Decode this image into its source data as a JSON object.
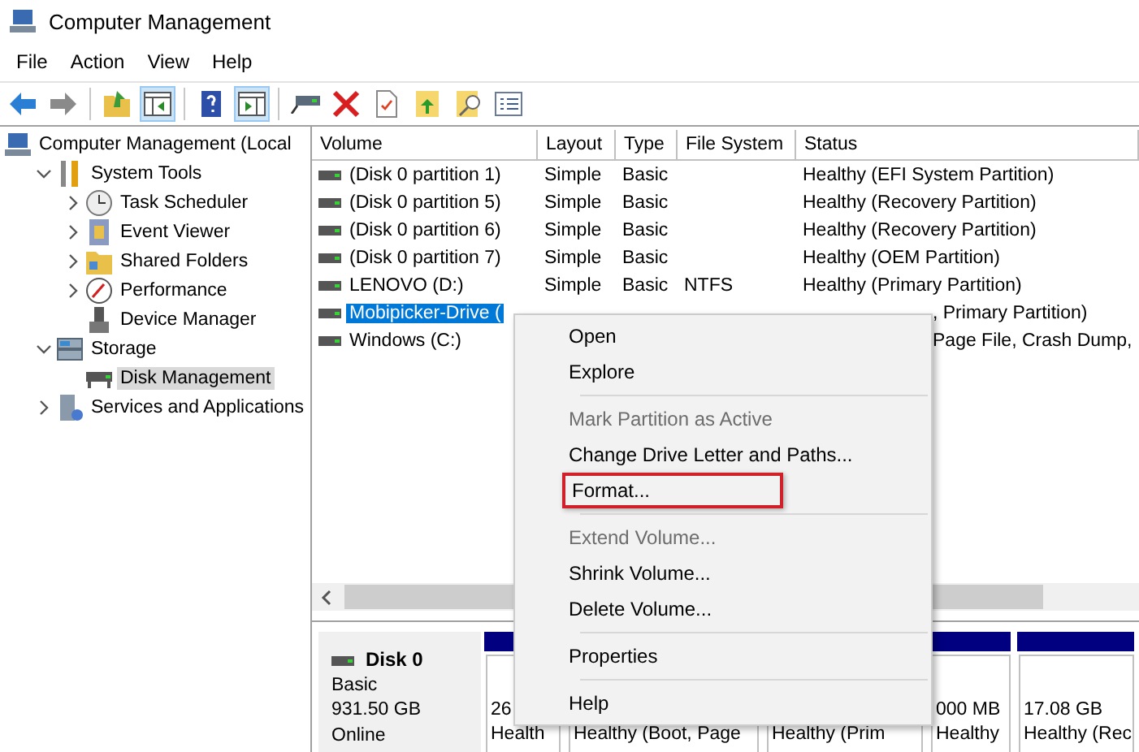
{
  "window": {
    "title": "Computer Management"
  },
  "menu_bar": [
    "File",
    "Action",
    "View",
    "Help"
  ],
  "toolbar": [
    {
      "kind": "back",
      "pressed": false
    },
    {
      "kind": "forward",
      "pressed": false
    },
    {
      "kind": "sep"
    },
    {
      "kind": "up",
      "pressed": false
    },
    {
      "kind": "tree",
      "pressed": true
    },
    {
      "kind": "sep"
    },
    {
      "kind": "help",
      "pressed": false
    },
    {
      "kind": "pane",
      "pressed": true
    },
    {
      "kind": "sep"
    },
    {
      "kind": "drive",
      "pressed": false
    },
    {
      "kind": "delete",
      "pressed": false
    },
    {
      "kind": "check",
      "pressed": false
    },
    {
      "kind": "folderup",
      "pressed": false
    },
    {
      "kind": "search",
      "pressed": false
    },
    {
      "kind": "list",
      "pressed": false
    }
  ],
  "tree": [
    {
      "label": "Computer Management (Local",
      "kind": "computer",
      "selected": false,
      "children": [
        {
          "label": "System Tools",
          "kind": "tools",
          "selected": false,
          "expanded": true,
          "children": [
            {
              "label": "Task Scheduler",
              "kind": "clock",
              "selected": false,
              "expanded": false
            },
            {
              "label": "Event Viewer",
              "kind": "log",
              "selected": false,
              "expanded": false
            },
            {
              "label": "Shared Folders",
              "kind": "folder",
              "selected": false,
              "expanded": false
            },
            {
              "label": "Performance",
              "kind": "gauge",
              "selected": false,
              "expanded": false
            },
            {
              "label": "Device Manager",
              "kind": "device",
              "selected": false
            }
          ]
        },
        {
          "label": "Storage",
          "kind": "storage",
          "selected": false,
          "expanded": true,
          "children": [
            {
              "label": "Disk Management",
              "kind": "disk",
              "selected": true
            }
          ]
        },
        {
          "label": "Services and Applications",
          "kind": "services",
          "selected": false,
          "expanded": false
        }
      ]
    }
  ],
  "table": {
    "columns": [
      "Volume",
      "Layout",
      "Type",
      "File System",
      "Status"
    ],
    "rows": [
      {
        "volume": "(Disk 0 partition 1)",
        "layout": "Simple",
        "type": "Basic",
        "status": "Healthy (EFI System Partition)",
        "selected": false,
        "status_under_menu": false
      },
      {
        "volume": "(Disk 0 partition 5)",
        "layout": "Simple",
        "type": "Basic",
        "status": "Healthy (Recovery Partition)",
        "selected": false,
        "status_under_menu": false
      },
      {
        "volume": "(Disk 0 partition 6)",
        "layout": "Simple",
        "type": "Basic",
        "status": "Healthy (Recovery Partition)",
        "selected": false,
        "status_under_menu": false
      },
      {
        "volume": "(Disk 0 partition 7)",
        "layout": "Simple",
        "type": "Basic",
        "status": "Healthy (OEM Partition)",
        "selected": false,
        "status_under_menu": false
      },
      {
        "volume": "LENOVO (D:)",
        "layout": "Simple",
        "type": "Basic",
        "file_system": "NTFS",
        "status": "Healthy (Primary Partition)",
        "selected": false,
        "status_under_menu": false
      },
      {
        "volume": "Mobipicker-Drive (",
        "status": ", Primary Partition)",
        "selected": true,
        "status_under_menu": true
      },
      {
        "volume": "Windows (C:)",
        "status": "Page File, Crash Dump,",
        "selected": false,
        "status_under_menu": true
      }
    ]
  },
  "disk": {
    "name": "Disk 0",
    "type": "Basic",
    "size": "931.50 GB",
    "state": "Online",
    "partitions": [
      {
        "size": "26",
        "status": "Health"
      },
      {
        "status": "Healthy (Boot, Page"
      },
      {
        "status": "Healthy (Prim"
      },
      {
        "size": "000 MB",
        "status": "Healthy"
      },
      {
        "size": "17.08 GB",
        "status": "Healthy (Rec"
      }
    ]
  },
  "context_menu": [
    {
      "kind": "item",
      "label": "Open",
      "disabled": false,
      "annotated": false
    },
    {
      "kind": "item",
      "label": "Explore",
      "disabled": false,
      "annotated": false
    },
    {
      "kind": "sep"
    },
    {
      "kind": "item",
      "label": "Mark Partition as Active",
      "disabled": true,
      "annotated": false
    },
    {
      "kind": "item",
      "label": "Change Drive Letter and Paths...",
      "disabled": false,
      "annotated": false
    },
    {
      "kind": "item",
      "label": "Format...",
      "disabled": false,
      "annotated": true
    },
    {
      "kind": "sep"
    },
    {
      "kind": "item",
      "label": "Extend Volume...",
      "disabled": true,
      "annotated": false
    },
    {
      "kind": "item",
      "label": "Shrink Volume...",
      "disabled": false,
      "annotated": false
    },
    {
      "kind": "item",
      "label": "Delete Volume...",
      "disabled": false,
      "annotated": false
    },
    {
      "kind": "sep"
    },
    {
      "kind": "item",
      "label": "Properties",
      "disabled": false,
      "annotated": false
    },
    {
      "kind": "sep"
    },
    {
      "kind": "item",
      "label": "Help",
      "disabled": false,
      "annotated": false
    }
  ]
}
